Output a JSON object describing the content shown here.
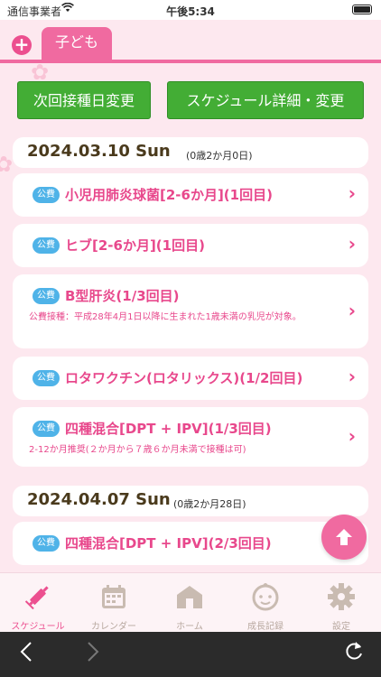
{
  "status": {
    "carrier": "通信事業者",
    "time": "午後5:34"
  },
  "top_tab": {
    "label": "子ども"
  },
  "actions": {
    "change_label": "次回接種日変更",
    "detail_label": "スケジュール詳細・変更"
  },
  "sections": [
    {
      "date": "2024.03.10 Sun",
      "age": "(0歳2か月0日)",
      "items": [
        {
          "badge": "公費",
          "title": "小児用肺炎球菌[2-6か月](1回目)",
          "note": ""
        },
        {
          "badge": "公費",
          "title": "ヒブ[2-6か月](1回目)",
          "note": ""
        },
        {
          "badge": "公費",
          "title": "B型肝炎(1/3回目)",
          "note": "公費接種：平成28年4月1日以降に生まれた1歳未満の乳児が対象。"
        },
        {
          "badge": "公費",
          "title": "ロタワクチン(ロタリックス)(1/2回目)",
          "note": ""
        },
        {
          "badge": "公費",
          "title": "四種混合[DPT + IPV](1/3回目)",
          "note": "2-12か月推奨(２か月から７歳６か月未満で接種は可)"
        }
      ]
    },
    {
      "date": "2024.04.07 Sun",
      "age": "(0歳2か月28日)",
      "items": [
        {
          "badge": "公費",
          "title": "四種混合[DPT + IPV](2/3回目)",
          "note": ""
        }
      ]
    }
  ],
  "bottom_tabs": [
    {
      "label": "スケジュール",
      "icon": "syringe-icon",
      "active": true
    },
    {
      "label": "カレンダー",
      "icon": "calendar-icon",
      "active": false
    },
    {
      "label": "ホーム",
      "icon": "home-icon",
      "active": false
    },
    {
      "label": "成長記録",
      "icon": "baby-face-icon",
      "active": false
    },
    {
      "label": "設定",
      "icon": "gear-icon",
      "active": false
    }
  ],
  "colors": {
    "accent": "#f06aa0",
    "green": "#43ad35",
    "badge": "#4fb3e8",
    "background": "#fde8ef"
  }
}
